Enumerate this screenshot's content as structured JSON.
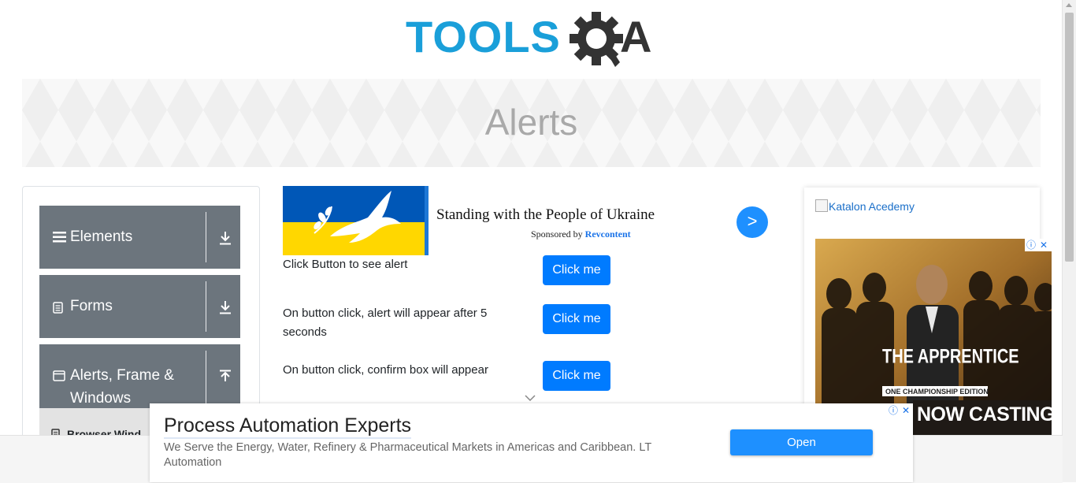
{
  "logo": {
    "text_primary": "TOOLS",
    "text_secondary": "A",
    "primary_color": "#1a9fd9",
    "secondary_color": "#333333"
  },
  "banner": {
    "title": "Alerts"
  },
  "sidebar": {
    "groups": [
      {
        "label": "Elements",
        "icon": "hamburger-icon",
        "arrow": "download-arrow-icon"
      },
      {
        "label": "Forms",
        "icon": "document-icon",
        "arrow": "download-arrow-icon"
      },
      {
        "label": "Alerts, Frame &",
        "label2": "Windows",
        "icon": "window-icon",
        "arrow": "upload-arrow-icon"
      }
    ],
    "sub_item": {
      "label": "Browser Wind",
      "icon": "document-icon"
    }
  },
  "ad_ukraine": {
    "title": "Standing with the People of Ukraine",
    "sponsored_prefix": "Sponsored by",
    "sponsor": "Revcontent",
    "next": ">"
  },
  "rows": [
    {
      "text": "Click Button to see alert",
      "button": "Click me"
    },
    {
      "text": "On button click, alert will appear after 5 seconds",
      "button": "Click me"
    },
    {
      "text": "On button click, confirm box will appear",
      "button": "Click me"
    }
  ],
  "right_ad": {
    "katalon_alt": "Katalon Acedemy",
    "apprentice_title": "THE APPRENTICE",
    "apprentice_sub": "ONE CHAMPIONSHIP EDITION",
    "now_casting": "NOW CASTING"
  },
  "bottom_ad": {
    "title": "Process Automation Experts",
    "description": "We Serve the Energy, Water, Refinery & Pharmaceutical Markets in Americas and Caribbean. LT Automation",
    "button": "Open"
  },
  "colors": {
    "primary_button": "#007bff",
    "sidebar_group": "#6c757d",
    "ad_button": "#1e90ff"
  }
}
